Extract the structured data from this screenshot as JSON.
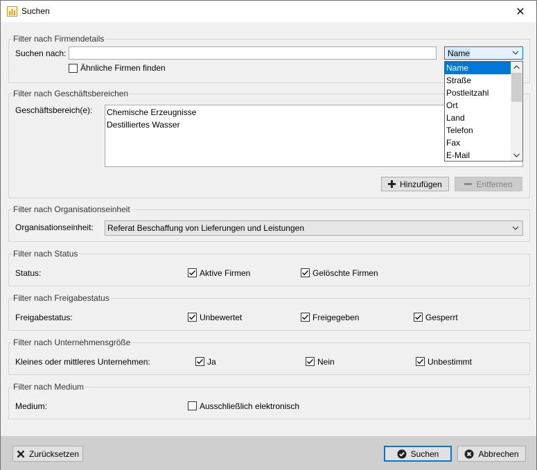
{
  "window": {
    "title": "Suchen",
    "close_glyph": "✕"
  },
  "firmendetails": {
    "group_title": "Filter nach Firmendetails",
    "search_label": "Suchen nach:",
    "search_value": "",
    "similar_label": "Ähnliche Firmen finden",
    "similar_checked": false,
    "field_selected": "Name",
    "field_options": [
      "Name",
      "Straße",
      "Postleitzahl",
      "Ort",
      "Land",
      "Telefon",
      "Fax",
      "E-Mail"
    ]
  },
  "geschaeftsbereiche": {
    "group_title": "Filter nach Geschäftsbereichen",
    "label": "Geschäftsbereich(e):",
    "items": [
      "Chemische Erzeugnisse",
      "Destilliertes Wasser"
    ],
    "add_label": "Hinzufügen",
    "remove_label": "Entfernen"
  },
  "organisation": {
    "group_title": "Filter nach Organisationseinheit",
    "label": "Organisationseinheit:",
    "value": "Referat Beschaffung von Lieferungen und Leistungen"
  },
  "status": {
    "group_title": "Filter nach Status",
    "label": "Status:",
    "options": [
      {
        "label": "Aktive Firmen",
        "checked": true
      },
      {
        "label": "Gelöschte Firmen",
        "checked": true
      }
    ]
  },
  "freigabe": {
    "group_title": "Filter nach Freigabestatus",
    "label": "Freigabestatus:",
    "options": [
      {
        "label": "Unbewertet",
        "checked": true
      },
      {
        "label": "Freigegeben",
        "checked": true
      },
      {
        "label": "Gesperrt",
        "checked": true
      }
    ]
  },
  "groesse": {
    "group_title": "Filter nach Unternehmensgröße",
    "label": "Kleines oder mittleres Unternehmen:",
    "options": [
      {
        "label": "Ja",
        "checked": true
      },
      {
        "label": "Nein",
        "checked": true
      },
      {
        "label": "Unbestimmt",
        "checked": true
      }
    ]
  },
  "medium": {
    "group_title": "Filter nach Medium",
    "label": "Medium:",
    "option": {
      "label": "Ausschließlich elektronisch",
      "checked": false
    }
  },
  "footer": {
    "reset_label": "Zurücksetzen",
    "search_label": "Suchen",
    "cancel_label": "Abbrechen"
  },
  "colors": {
    "selection": "#0078d7",
    "footer_bg": "#cfcfcf",
    "dialog_bg": "#f0f0f0"
  }
}
